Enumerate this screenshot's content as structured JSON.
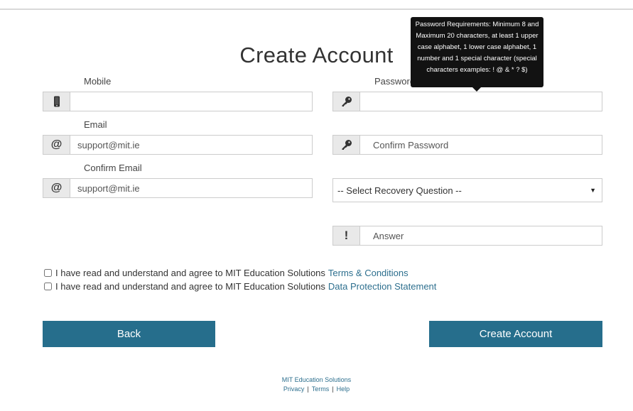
{
  "page_title": "Create Account",
  "form": {
    "mobile": {
      "label": "Mobile",
      "value": "",
      "icon": "phone-icon"
    },
    "email": {
      "label": "Email",
      "placeholder": "support@mit.ie",
      "icon": "at-icon"
    },
    "confirm_email": {
      "label": "Confirm Email",
      "placeholder": "support@mit.ie",
      "icon": "at-icon"
    },
    "password": {
      "label": "Password",
      "value": "",
      "icon": "key-icon"
    },
    "confirm_password": {
      "placeholder": "Confirm Password",
      "icon": "key-icon"
    },
    "recovery_question": {
      "selected": "-- Select Recovery Question --"
    },
    "answer": {
      "placeholder": "Answer",
      "icon": "exclamation-icon"
    }
  },
  "tooltip": {
    "text": "Password Requirements: Minimum 8 and Maximum 20 characters, at least 1 upper case alphabet, 1 lower case alphabet, 1 number and 1 special character (special characters examples: ! @ & * ? $)"
  },
  "agreements": {
    "terms_text": "I have read and understand and agree to MIT Education Solutions",
    "terms_link": "Terms & Conditions",
    "data_text": "I have read and understand and agree to MIT Education Solutions",
    "data_link": "Data Protection Statement"
  },
  "buttons": {
    "back": "Back",
    "create": "Create Account"
  },
  "footer": {
    "company": "MIT Education Solutions",
    "privacy": "Privacy",
    "terms": "Terms",
    "help": "Help",
    "separator": "|"
  },
  "colors": {
    "primary": "#266e8c",
    "link": "#2d6f8e",
    "tooltip_bg": "#121212"
  }
}
